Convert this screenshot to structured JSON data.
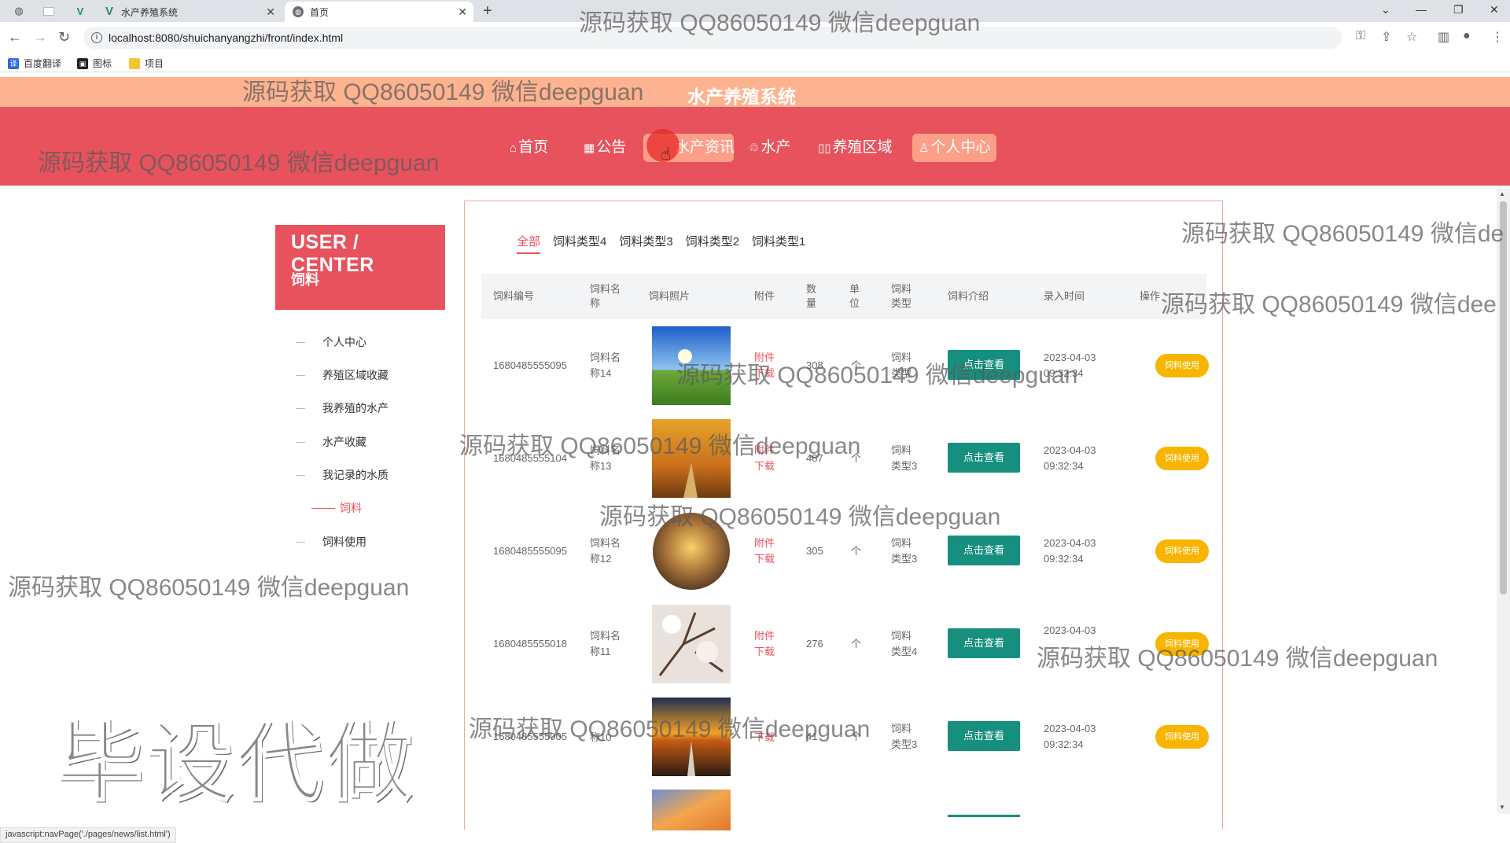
{
  "browser": {
    "tabs": [
      {
        "title": "水产养殖系统"
      },
      {
        "title": "首页"
      }
    ],
    "url": "localhost:8080/shuichanyangzhi/front/index.html",
    "bookmarks": [
      "百度翻译",
      "图标",
      "项目"
    ],
    "status_text": "javascript:navPage('./pages/news/list.html')"
  },
  "site": {
    "title": "水产养殖系统",
    "nav": [
      {
        "icon": "⌂",
        "label": "首页"
      },
      {
        "icon": "▦",
        "label": "公告"
      },
      {
        "icon": "",
        "label": "水产资讯"
      },
      {
        "icon": "♲",
        "label": "水产"
      },
      {
        "icon": "▯▯",
        "label": "养殖区域"
      },
      {
        "icon": "♙",
        "label": "个人中心"
      }
    ]
  },
  "sidebar": {
    "title": "USER / CENTER",
    "subtitle": "饲料",
    "items": [
      "个人中心",
      "养殖区域收藏",
      "我养殖的水产",
      "水产收藏",
      "我记录的水质",
      "饲料",
      "饲料使用"
    ]
  },
  "categories": [
    "全部",
    "饲料类型4",
    "饲料类型3",
    "饲料类型2",
    "饲料类型1"
  ],
  "table": {
    "headers": [
      "饲料编号",
      "饲料名称",
      "饲料照片",
      "附件",
      "数量",
      "单位",
      "饲料类型",
      "饲料介绍",
      "录入时间",
      "操作"
    ],
    "rows": [
      {
        "id": "1680485555095",
        "name": "饲料名称14",
        "attachment": "附件下载",
        "qty": "308",
        "unit": "个",
        "type": "饲料类型",
        "view": "点击查看",
        "time": "2023-04-03 09:32:34",
        "action": "饲料使用",
        "photo": "field"
      },
      {
        "id": "1680485555104",
        "name": "饲料名称13",
        "attachment": "附件下载",
        "qty": "487",
        "unit": "个",
        "type": "饲料类型3",
        "view": "点击查看",
        "time": "2023-04-03 09:32:34",
        "action": "饲料使用",
        "photo": "autumn"
      },
      {
        "id": "1680485555095",
        "name": "饲料名称12",
        "attachment": "附件下载",
        "qty": "305",
        "unit": "个",
        "type": "饲料类型3",
        "view": "点击查看",
        "time": "2023-04-03 09:32:34",
        "action": "饲料使用",
        "photo": "desert"
      },
      {
        "id": "1680485555018",
        "name": "饲料名称11",
        "attachment": "附件下载",
        "qty": "276",
        "unit": "个",
        "type": "饲料类型4",
        "view": "点击查看",
        "time": "2023-04-03",
        "action": "饲料使用",
        "photo": "blossom"
      },
      {
        "id": "1680485555005",
        "name": "称10",
        "attachment": "下载",
        "qty": "41",
        "unit": "个",
        "type": "饲料类型3",
        "view": "点击查看",
        "time": "2023-04-03 09:32:34",
        "action": "饲料使用",
        "photo": "sunset"
      }
    ]
  },
  "watermarks": {
    "text": "源码获取 QQ86050149 微信deepguan",
    "clipped_a": "源码获取 QQ86050149 微信de",
    "clipped_b": "源码获取 QQ86050149 微信dee",
    "big": "毕设代做"
  },
  "colors": {
    "nav_red": "#e8525d",
    "top_orange": "#fdb38f",
    "view_teal": "#178f7f",
    "use_yellow": "#f7b500"
  }
}
